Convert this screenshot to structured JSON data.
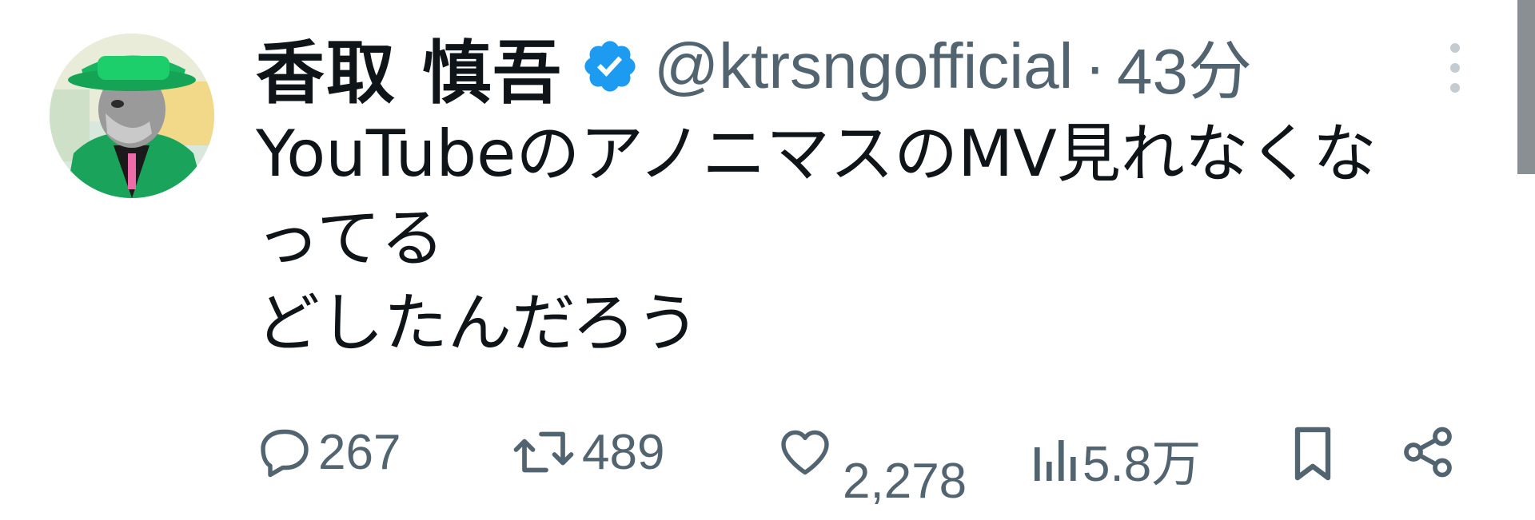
{
  "tweet": {
    "display_name": "香取 慎吾",
    "handle": "@ktrsngofficial",
    "separator": "·",
    "timestamp": "43分",
    "verified": true,
    "text_lines": [
      "YouTubeのアノニマスのMV見れなくな",
      "ってる",
      "どしたんだろう"
    ]
  },
  "actions": {
    "reply_count": "267",
    "retweet_count": "489",
    "like_count": "2,278",
    "views_count": "5.8万"
  },
  "icons": {
    "verified": "verified-badge-icon",
    "more": "more-vertical-icon",
    "reply": "reply-bubble-icon",
    "retweet": "retweet-icon",
    "like": "heart-icon",
    "views": "views-bar-chart-icon",
    "bookmark": "bookmark-icon",
    "share": "share-icon"
  },
  "colors": {
    "text_primary": "#0f1419",
    "text_secondary": "#536471",
    "verified_blue": "#1d9bf0",
    "avatar_green": "#1fc06b"
  }
}
